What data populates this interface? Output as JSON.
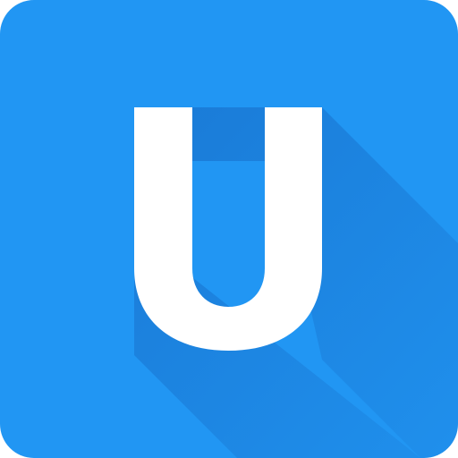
{
  "icon": {
    "name": "letter-u-app-icon",
    "letter": "U",
    "background_color": "#2196F3",
    "letter_color": "#FFFFFF",
    "shadow_color": "#0D47A1"
  }
}
